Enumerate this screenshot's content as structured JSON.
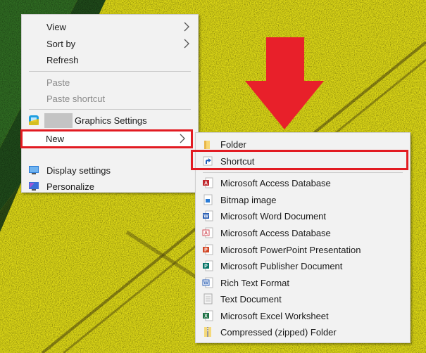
{
  "main_menu": {
    "items": [
      {
        "label": "View",
        "icon": null,
        "submenu": true,
        "enabled": true
      },
      {
        "label": "Sort by",
        "icon": null,
        "submenu": true,
        "enabled": true
      },
      {
        "label": "Refresh",
        "icon": null,
        "submenu": false,
        "enabled": true
      },
      {
        "label": "Paste",
        "icon": null,
        "submenu": false,
        "enabled": false
      },
      {
        "label": "Paste shortcut",
        "icon": null,
        "submenu": false,
        "enabled": false
      },
      {
        "label": "Graphics Settings",
        "icon": "graphics-settings-icon",
        "submenu": false,
        "enabled": true
      },
      {
        "label": "New",
        "icon": null,
        "submenu": true,
        "enabled": true,
        "highlighted": true
      },
      {
        "label": "Display settings",
        "icon": "display-settings-icon",
        "submenu": false,
        "enabled": true
      },
      {
        "label": "Personalize",
        "icon": "personalize-icon",
        "submenu": false,
        "enabled": true
      }
    ]
  },
  "new_submenu": {
    "items": [
      {
        "label": "Folder",
        "icon": "folder-icon"
      },
      {
        "label": "Shortcut",
        "icon": "shortcut-icon",
        "highlighted": true
      },
      {
        "label": "Microsoft Access Database",
        "icon": "access-icon"
      },
      {
        "label": "Bitmap image",
        "icon": "bitmap-icon"
      },
      {
        "label": "Microsoft Word Document",
        "icon": "word-icon"
      },
      {
        "label": "Microsoft Access Database",
        "icon": "access-icon"
      },
      {
        "label": "Microsoft PowerPoint Presentation",
        "icon": "powerpoint-icon"
      },
      {
        "label": "Microsoft Publisher Document",
        "icon": "publisher-icon"
      },
      {
        "label": "Rich Text Format",
        "icon": "rtf-icon"
      },
      {
        "label": "Text Document",
        "icon": "text-document-icon"
      },
      {
        "label": "Microsoft Excel Worksheet",
        "icon": "excel-icon"
      },
      {
        "label": "Compressed (zipped) Folder",
        "icon": "zip-folder-icon"
      }
    ]
  },
  "colors": {
    "highlight": "#e21b22",
    "menu_bg": "#f2f2f2",
    "disabled_text": "#8a8a8a"
  }
}
